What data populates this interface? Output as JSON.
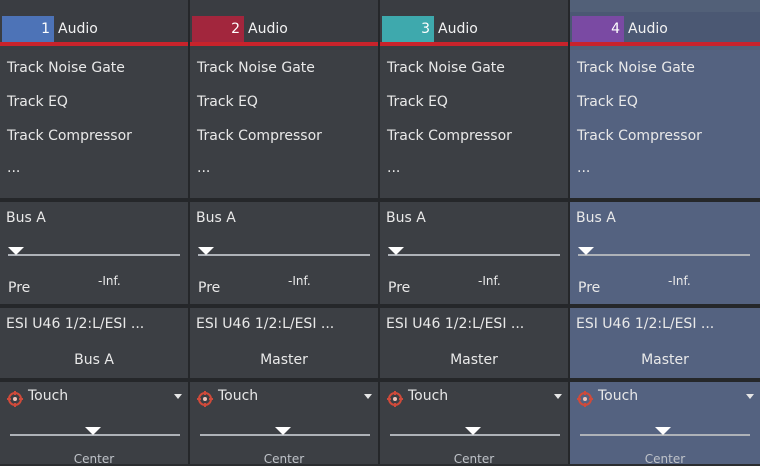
{
  "tracks": [
    {
      "number": "1",
      "name": "Audio",
      "color": "#4d73b7",
      "fx": [
        "Track Noise Gate",
        "Track EQ",
        "Track Compressor",
        "..."
      ],
      "send": {
        "bus": "Bus A",
        "mode": "Pre",
        "level": "-Inf."
      },
      "io": {
        "input": "ESI U46 1/2:L/ESI ...",
        "output": "Bus A"
      },
      "automation": {
        "mode": "Touch",
        "pan": "Center"
      }
    },
    {
      "number": "2",
      "name": "Audio",
      "color": "#a2263d",
      "fx": [
        "Track Noise Gate",
        "Track EQ",
        "Track Compressor",
        "..."
      ],
      "send": {
        "bus": "Bus A",
        "mode": "Pre",
        "level": "-Inf."
      },
      "io": {
        "input": "ESI U46 1/2:L/ESI ...",
        "output": "Master"
      },
      "automation": {
        "mode": "Touch",
        "pan": "Center"
      }
    },
    {
      "number": "3",
      "name": "Audio",
      "color": "#3ea9ad",
      "fx": [
        "Track Noise Gate",
        "Track EQ",
        "Track Compressor",
        "..."
      ],
      "send": {
        "bus": "Bus A",
        "mode": "Pre",
        "level": "-Inf."
      },
      "io": {
        "input": "ESI U46 1/2:L/ESI ...",
        "output": "Master"
      },
      "automation": {
        "mode": "Touch",
        "pan": "Center"
      }
    },
    {
      "number": "4",
      "name": "Audio",
      "color": "#7a4aa3",
      "fx": [
        "Track Noise Gate",
        "Track EQ",
        "Track Compressor",
        "..."
      ],
      "send": {
        "bus": "Bus A",
        "mode": "Pre",
        "level": "-Inf."
      },
      "io": {
        "input": "ESI U46 1/2:L/ESI ...",
        "output": "Master"
      },
      "automation": {
        "mode": "Touch",
        "pan": "Center"
      }
    }
  ],
  "colors": {
    "strip_bg": "#3c3f44",
    "selected_bg": "#546280",
    "header_line": "#c8232b"
  }
}
